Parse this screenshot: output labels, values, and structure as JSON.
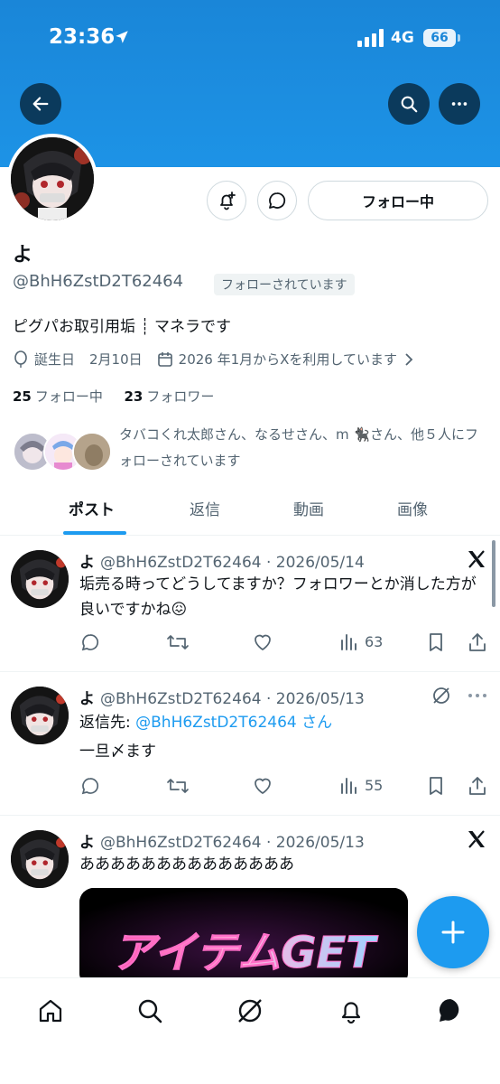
{
  "status_bar": {
    "time": "23:36",
    "network": "4G",
    "battery": "66"
  },
  "profile": {
    "name": "よ",
    "handle": "@BhH6ZstD2T62464",
    "follows_you_badge": "フォローされています",
    "bio": "ピグパお取引用垢 ┊ マネラです",
    "birthday_label": "誕生日",
    "birthday": "2月10日",
    "joined": "2026 年1月からXを利用しています",
    "following_count": "25",
    "following_label": "フォロー中",
    "followers_count": "23",
    "followers_label": "フォロワー",
    "followed_by_text": "タバコくれ太郎さん、なるせさん、m 🐈‍⬛さん、他５人にフォローされています",
    "follow_button": "フォロー中"
  },
  "tabs": [
    {
      "label": "ポスト",
      "active": true
    },
    {
      "label": "返信",
      "active": false
    },
    {
      "label": "動画",
      "active": false
    },
    {
      "label": "画像",
      "active": false
    }
  ],
  "posts": [
    {
      "name": "よ",
      "meta": "@BhH6ZstD2T62464 · 2026/05/14",
      "text": "垢売る時ってどうしてますか？フォロワーとか消した方が良いですかね😖",
      "views": "63",
      "corner_icon": "x-logo-icon"
    },
    {
      "name": "よ",
      "meta": "@BhH6ZstD2T62464 · 2026/05/13",
      "reply_prefix": "返信先: ",
      "reply_handle": "@BhH6ZstD2T62464 さん",
      "text": "一旦〆ます",
      "views": "55",
      "corner_icon": "grok-icon"
    },
    {
      "name": "よ",
      "meta": "@BhH6ZstD2T62464 · 2026/05/13",
      "text": "ああああああああああああああ",
      "media_text": "アイテムGET",
      "corner_icon": "x-logo-icon"
    }
  ],
  "colors": {
    "banner": "#1d93e6",
    "accent": "#1d9bf0",
    "text": "#0f1419",
    "muted": "#536471"
  }
}
